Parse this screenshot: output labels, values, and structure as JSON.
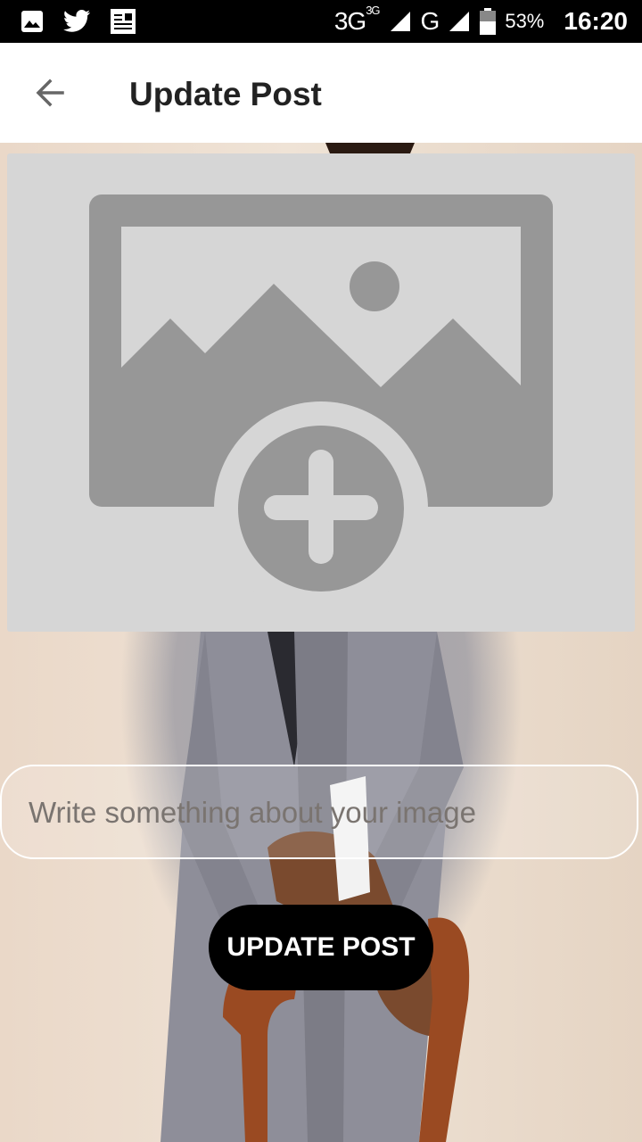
{
  "status_bar": {
    "network_1": "3G",
    "network_1_sup": "3G",
    "network_2": "G",
    "battery": "53%",
    "time": "16:20",
    "icons": [
      "image-icon",
      "twitter-icon",
      "news-icon",
      "signal-icon",
      "battery-icon"
    ]
  },
  "app_bar": {
    "title": "Update Post",
    "back_icon": "arrow-left-icon"
  },
  "image_picker": {
    "icon": "add-photo-icon"
  },
  "caption": {
    "placeholder": "Write something about your image",
    "value": ""
  },
  "actions": {
    "update_label": "UPDATE POST"
  },
  "colors": {
    "button_bg": "#000000",
    "picker_bg": "#d6d6d6",
    "picker_icon": "#979797"
  }
}
